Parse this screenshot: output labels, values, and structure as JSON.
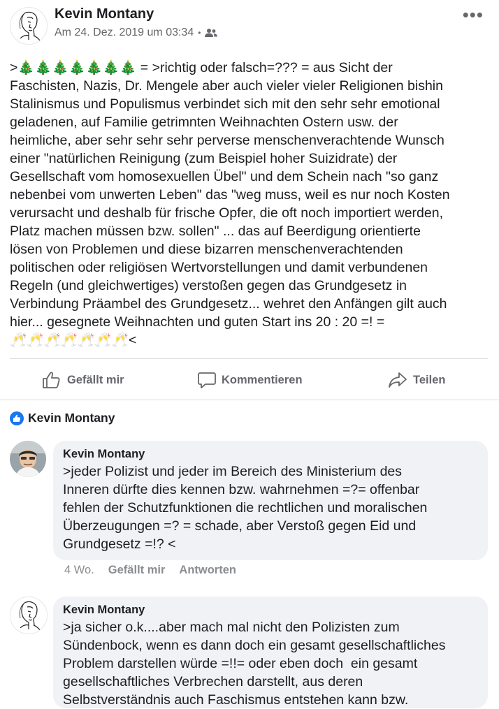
{
  "post": {
    "author": "Kevin Montany",
    "timestamp": "Am 24. Dez. 2019 um 03:34",
    "separator": "•",
    "audience_icon": "friends-icon",
    "more_icon": "more-icon",
    "more_label": "•••",
    "text": ">🎄🎄🎄🎄🎄🎄🎄 = >richtig oder falsch=??? = aus Sicht der\nFaschisten, Nazis, Dr. Mengele aber auch vieler vieler Religionen bishin\nStalinismus und Populismus verbindet sich mit den sehr sehr emotional\ngeladenen, auf Familie getrimnten Weihnachten Ostern usw. der\nheimliche, aber sehr sehr sehr perverse menschenverachtende Wunsch\neiner \"natürlichen Reinigung (zum Beispiel hoher Suizidrate) der\nGesellschaft vom homosexuellen Übel\" und dem Schein nach \"so ganz\nnebenbei vom unwerten Leben\" das \"weg muss, weil es nur noch Kosten\nverursacht und deshalb für frische Opfer, die oft noch importiert werden,\nPlatz machen müssen bzw. sollen\" ... das auf Beerdigung orientierte\nlösen von Problemen und diese bizarren menschenverachtenden\npolitischen oder religiösen Wertvorstellungen und damit verbundenen\nRegeln (und gleichwertiges) verstoßen gegen das Grundgesetz in\nVerbindung Präambel des Grundgesetz... wehret den Anfängen gilt auch\nhier... gesegnete Weihnachten und guten Start ins 20 : 20 =! =\n🥂🥂🥂🥂🥂🥂🥂<"
  },
  "actions": {
    "like": "Gefällt mir",
    "comment": "Kommentieren",
    "share": "Teilen"
  },
  "reactions": {
    "icon": "like-icon",
    "liker": "Kevin Montany"
  },
  "comments": [
    {
      "author": "Kevin Montany",
      "text": ">jeder Polizist und jeder im Bereich des Ministerium des\nInneren dürfte dies kennen bzw. wahrnehmen =?= offenbar\nfehlen der Schutzfunktionen die rechtlichen und moralischen\nÜberzeugungen =? = schade, aber Verstoß gegen Eid und\nGrundgesetz =!? <",
      "age": "4 Wo.",
      "like": "Gefällt mir",
      "reply": "Antworten"
    },
    {
      "author": "Kevin Montany",
      "text": ">ja sicher o.k....aber mach mal nicht den Polizisten zum\nSündenbock, wenn es dann doch ein gesamt gesellschaftliches\nProblem darstellen würde =!!= oder eben doch  ein gesamt\ngesellschaftliches Verbrechen darstellt, aus deren\nSelbstverständnis auch Faschismus entstehen kann bzw."
    }
  ]
}
